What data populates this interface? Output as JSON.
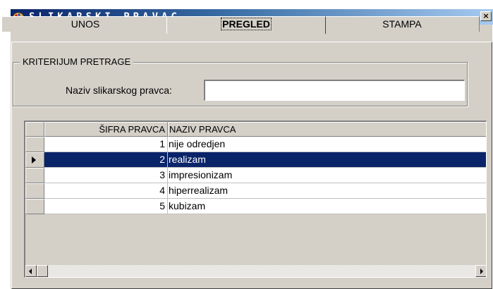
{
  "window": {
    "title": "SLIKARSKI PRAVAC",
    "close_label": "×",
    "icon": "palette-icon"
  },
  "tabs": [
    {
      "label": "UNOS",
      "active": false
    },
    {
      "label": "PREGLED",
      "active": true
    },
    {
      "label": "STAMPA",
      "active": false
    }
  ],
  "search": {
    "group_title": "KRITERIJUM PRETRAGE",
    "field_label": "Naziv slikarskog pravca:",
    "value": ""
  },
  "table": {
    "columns": [
      "ŠIFRA PRAVCA",
      "NAZIV PRAVCA"
    ],
    "rows": [
      {
        "sifra": "1",
        "naziv": "nije odredjen"
      },
      {
        "sifra": "2",
        "naziv": "realizam"
      },
      {
        "sifra": "3",
        "naziv": "impresionizam"
      },
      {
        "sifra": "4",
        "naziv": "hiperrealizam"
      },
      {
        "sifra": "5",
        "naziv": "kubizam"
      }
    ],
    "selected_index": 1
  },
  "colors": {
    "title_bar_start": "#0a246a",
    "selection": "#0a246a",
    "face": "#d4d0c8"
  }
}
